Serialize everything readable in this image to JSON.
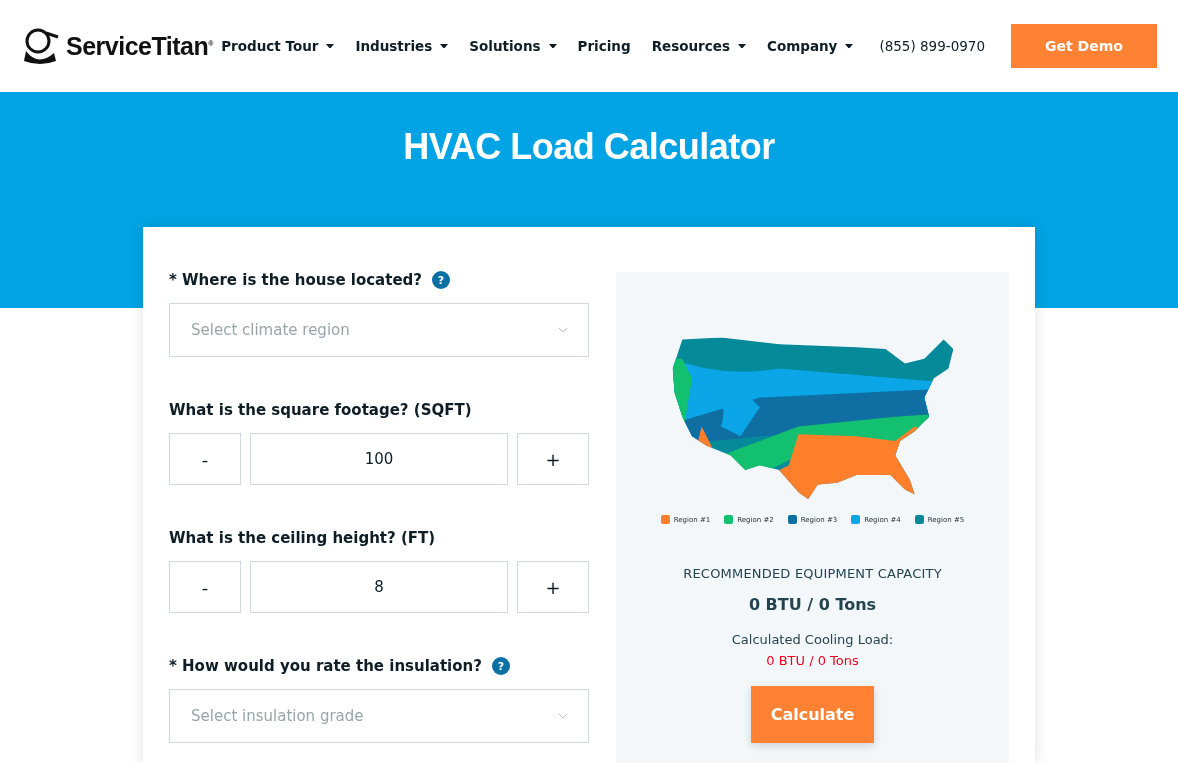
{
  "header": {
    "brand": "ServiceTitan",
    "brand_mark": "®",
    "nav": [
      {
        "label": "Product Tour",
        "dropdown": true
      },
      {
        "label": "Industries",
        "dropdown": true
      },
      {
        "label": "Solutions",
        "dropdown": true
      },
      {
        "label": "Pricing",
        "dropdown": false
      },
      {
        "label": "Resources",
        "dropdown": true
      },
      {
        "label": "Company",
        "dropdown": true
      }
    ],
    "phone": "(855) 899-0970",
    "cta": "Get Demo"
  },
  "hero": {
    "title": "HVAC Load Calculator"
  },
  "form": {
    "fields": [
      {
        "kind": "select",
        "label": "* Where is the house located?",
        "help": "?",
        "placeholder": "Select climate region"
      },
      {
        "kind": "stepper",
        "label": "What is the square footage? (SQFT)",
        "minus": "-",
        "value": "100",
        "plus": "+"
      },
      {
        "kind": "stepper",
        "label": "What is the ceiling height? (FT)",
        "minus": "-",
        "value": "8",
        "plus": "+"
      },
      {
        "kind": "select",
        "label": "* How would you rate the insulation?",
        "help": "?",
        "placeholder": "Select insulation grade"
      }
    ]
  },
  "result": {
    "legend": [
      {
        "label": "Region #1",
        "color": "#ff7f2a"
      },
      {
        "label": "Region #2",
        "color": "#13c06f"
      },
      {
        "label": "Region #3",
        "color": "#0f6fa3"
      },
      {
        "label": "Region #4",
        "color": "#0aa6e8"
      },
      {
        "label": "Region #5",
        "color": "#058a99"
      }
    ],
    "capacity_label": "RECOMMENDED EQUIPMENT CAPACITY",
    "capacity": "0 BTU / 0 Tons",
    "cooling_label": "Calculated Cooling Load:",
    "cooling": "0 BTU / 0 Tons",
    "button": "Calculate"
  }
}
